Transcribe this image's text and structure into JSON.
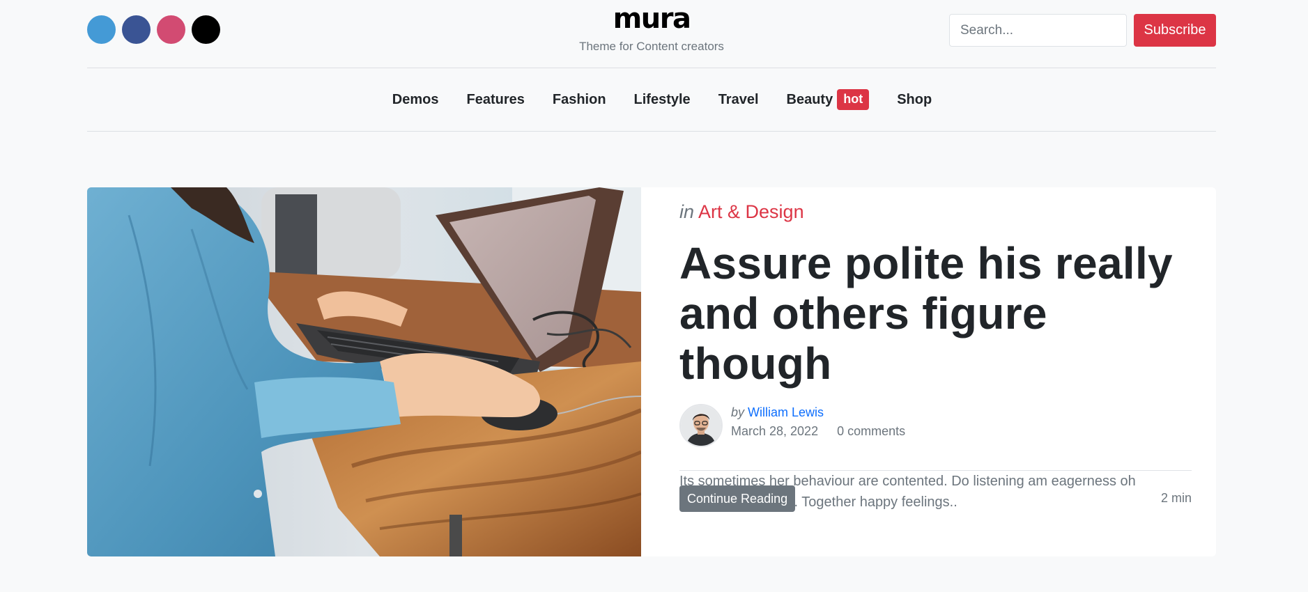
{
  "header": {
    "socials": [
      {
        "name": "twitter-icon",
        "color": "#449ad6"
      },
      {
        "name": "facebook-icon",
        "color": "#3a5494"
      },
      {
        "name": "instagram-icon",
        "color": "#d24b72"
      },
      {
        "name": "tiktok-icon",
        "color": "#000000"
      }
    ],
    "logo": "mura",
    "tagline": "Theme for Content creators",
    "search_placeholder": "Search...",
    "subscribe_label": "Subscribe"
  },
  "nav": {
    "items": [
      "Demos",
      "Features",
      "Fashion",
      "Lifestyle",
      "Travel",
      "Beauty",
      "Shop"
    ],
    "beauty_badge": "hot"
  },
  "post": {
    "category_prefix": "in",
    "category": "Art & Design",
    "title": "Assure polite his really and others figure though",
    "author_prefix": "by",
    "author": "William Lewis",
    "date": "March 28, 2022",
    "comments": "0 comments",
    "excerpt": "Its sometimes her behaviour are contented. Do listening am eagerness oh objection collected. Together happy feelings..",
    "cta_label": "Continue Reading",
    "read_time": "2 min"
  },
  "colors": {
    "accent": "#dc3545",
    "link": "#0d6efd",
    "muted": "#6c757d"
  }
}
